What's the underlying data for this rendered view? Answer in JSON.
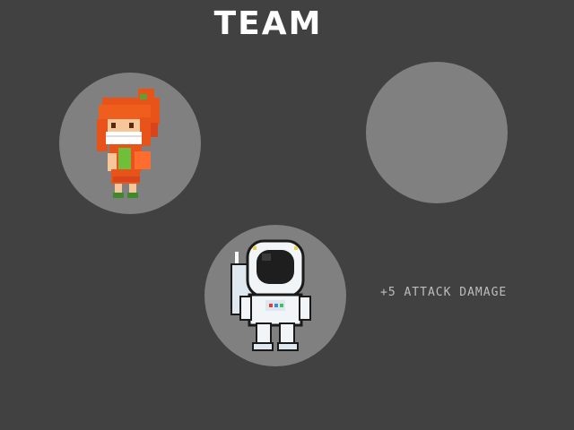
{
  "screen": {
    "title": "TEAM"
  },
  "team_slots": [
    {
      "character": "redhead-girl",
      "filled": true
    },
    {
      "character": "",
      "filled": false
    },
    {
      "character": "astronaut",
      "filled": true
    }
  ],
  "selected": {
    "bonus_text": "+5 ATTACK DAMAGE"
  },
  "colors": {
    "background": "#414141",
    "slot": "#808080",
    "title": "#ffffff",
    "bonus_text": "#bdbdbd"
  }
}
